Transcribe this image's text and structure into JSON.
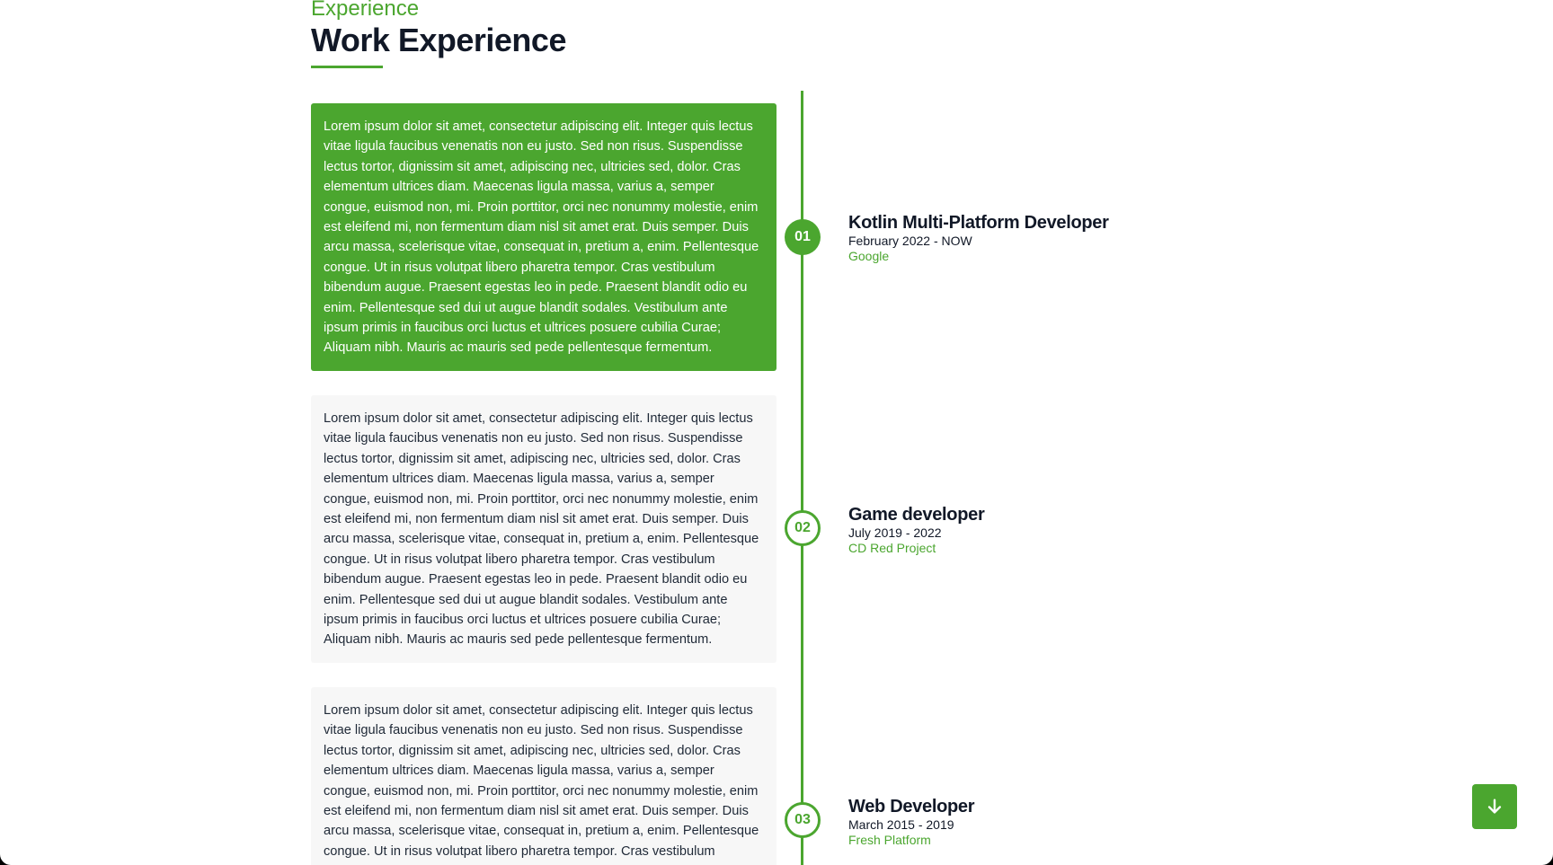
{
  "section": {
    "eyebrow": "Experience",
    "title": "Work Experience"
  },
  "colors": {
    "accent": "#4ba62f",
    "heading": "#111827",
    "card_inactive_bg": "#f7f7f7"
  },
  "experiences": [
    {
      "number": "01",
      "title": "Kotlin Multi-Platform Developer",
      "dates": "February 2022 - NOW",
      "company": "Google",
      "description": "Lorem ipsum dolor sit amet, consectetur adipiscing elit. Integer quis lectus vitae ligula faucibus venenatis non eu justo. Sed non risus. Suspendisse lectus tortor, dignissim sit amet, adipiscing nec, ultricies sed, dolor. Cras elementum ultrices diam. Maecenas ligula massa, varius a, semper congue, euismod non, mi. Proin porttitor, orci nec nonummy molestie, enim est eleifend mi, non fermentum diam nisl sit amet erat. Duis semper. Duis arcu massa, scelerisque vitae, consequat in, pretium a, enim. Pellentesque congue. Ut in risus volutpat libero pharetra tempor. Cras vestibulum bibendum augue. Praesent egestas leo in pede. Praesent blandit odio eu enim. Pellentesque sed dui ut augue blandit sodales. Vestibulum ante ipsum primis in faucibus orci luctus et ultrices posuere cubilia Curae; Aliquam nibh. Mauris ac mauris sed pede pellentesque fermentum.",
      "active": true
    },
    {
      "number": "02",
      "title": "Game developer",
      "dates": "July 2019 - 2022",
      "company": "CD Red Project",
      "description": "Lorem ipsum dolor sit amet, consectetur adipiscing elit. Integer quis lectus vitae ligula faucibus venenatis non eu justo. Sed non risus. Suspendisse lectus tortor, dignissim sit amet, adipiscing nec, ultricies sed, dolor. Cras elementum ultrices diam. Maecenas ligula massa, varius a, semper congue, euismod non, mi. Proin porttitor, orci nec nonummy molestie, enim est eleifend mi, non fermentum diam nisl sit amet erat. Duis semper. Duis arcu massa, scelerisque vitae, consequat in, pretium a, enim. Pellentesque congue. Ut in risus volutpat libero pharetra tempor. Cras vestibulum bibendum augue. Praesent egestas leo in pede. Praesent blandit odio eu enim. Pellentesque sed dui ut augue blandit sodales. Vestibulum ante ipsum primis in faucibus orci luctus et ultrices posuere cubilia Curae; Aliquam nibh. Mauris ac mauris sed pede pellentesque fermentum.",
      "active": false
    },
    {
      "number": "03",
      "title": "Web Developer",
      "dates": "March 2015 - 2019",
      "company": "Fresh Platform",
      "description": "Lorem ipsum dolor sit amet, consectetur adipiscing elit. Integer quis lectus vitae ligula faucibus venenatis non eu justo. Sed non risus. Suspendisse lectus tortor, dignissim sit amet, adipiscing nec, ultricies sed, dolor. Cras elementum ultrices diam. Maecenas ligula massa, varius a, semper congue, euismod non, mi. Proin porttitor, orci nec nonummy molestie, enim est eleifend mi, non fermentum diam nisl sit amet erat. Duis semper. Duis arcu massa, scelerisque vitae, consequat in, pretium a, enim. Pellentesque congue. Ut in risus volutpat libero pharetra tempor. Cras vestibulum",
      "active": false
    }
  ],
  "scroll_button": {
    "icon": "arrow-down-icon"
  }
}
